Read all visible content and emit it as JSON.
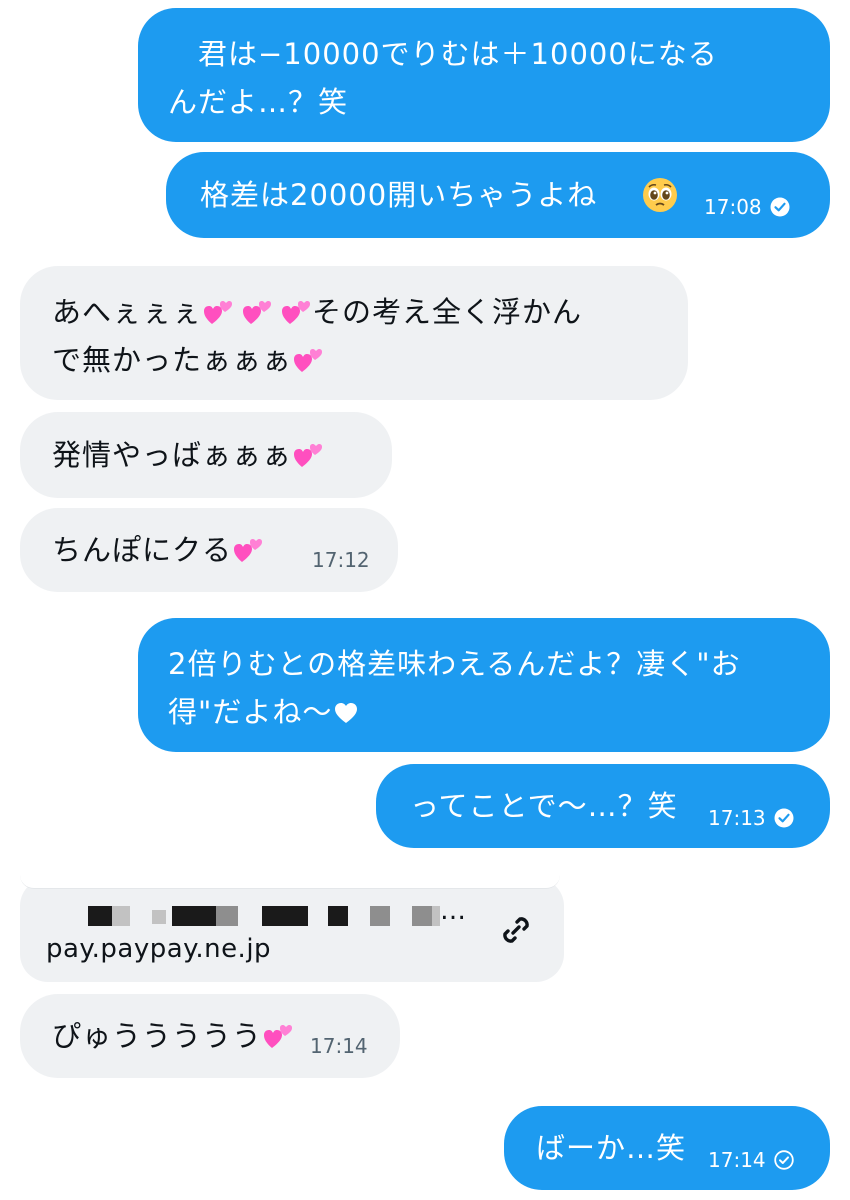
{
  "messages": [
    {
      "id": "m1",
      "dir": "out",
      "lines": [
        "　君は−10000でりむは＋10000になる",
        "んだよ…？笑"
      ]
    },
    {
      "id": "m2",
      "dir": "out",
      "lines": [
        "格差は20000開いちゃうよね"
      ],
      "emoji": "pleading-face-icon",
      "time": "17:08",
      "read": true
    },
    {
      "id": "m3",
      "dir": "in",
      "line1_a": "あへぇぇぇ",
      "line1_b": "その考え全く浮かん",
      "line2": "で無かったぁぁぁ"
    },
    {
      "id": "m4",
      "dir": "in",
      "lines": [
        "発情やっばぁぁぁ"
      ]
    },
    {
      "id": "m5",
      "dir": "in",
      "lines": [
        "ちんぽにクる"
      ],
      "time": "17:12"
    },
    {
      "id": "m6",
      "dir": "out",
      "lines": [
        "2倍りむとの格差味わえるんだよ？凄く\"お",
        "得\"だよね〜"
      ],
      "emoji": "heart-icon"
    },
    {
      "id": "m7",
      "dir": "out",
      "lines": [
        "ってことで〜…？笑"
      ],
      "time": "17:13",
      "read": true
    },
    {
      "id": "m8",
      "dir": "in",
      "kind": "link",
      "url": "pay.paypay.ne.jp",
      "title_ellipsis": "…"
    },
    {
      "id": "m9",
      "dir": "in",
      "lines": [
        "ぴゅううううう"
      ],
      "time": "17:14"
    },
    {
      "id": "m10",
      "dir": "out",
      "lines": [
        "ばーか…笑"
      ],
      "time": "17:14",
      "read": false
    }
  ],
  "colors": {
    "outgoing": "#1d9bf0",
    "incoming": "#eff1f3",
    "heart": "#ff4fbf",
    "text_dark": "#0f1419",
    "time_gray": "#536471"
  },
  "icons": [
    "two-hearts-icon",
    "pleading-face-icon",
    "heart-icon",
    "link-icon",
    "read-check-icon",
    "sent-check-icon"
  ]
}
